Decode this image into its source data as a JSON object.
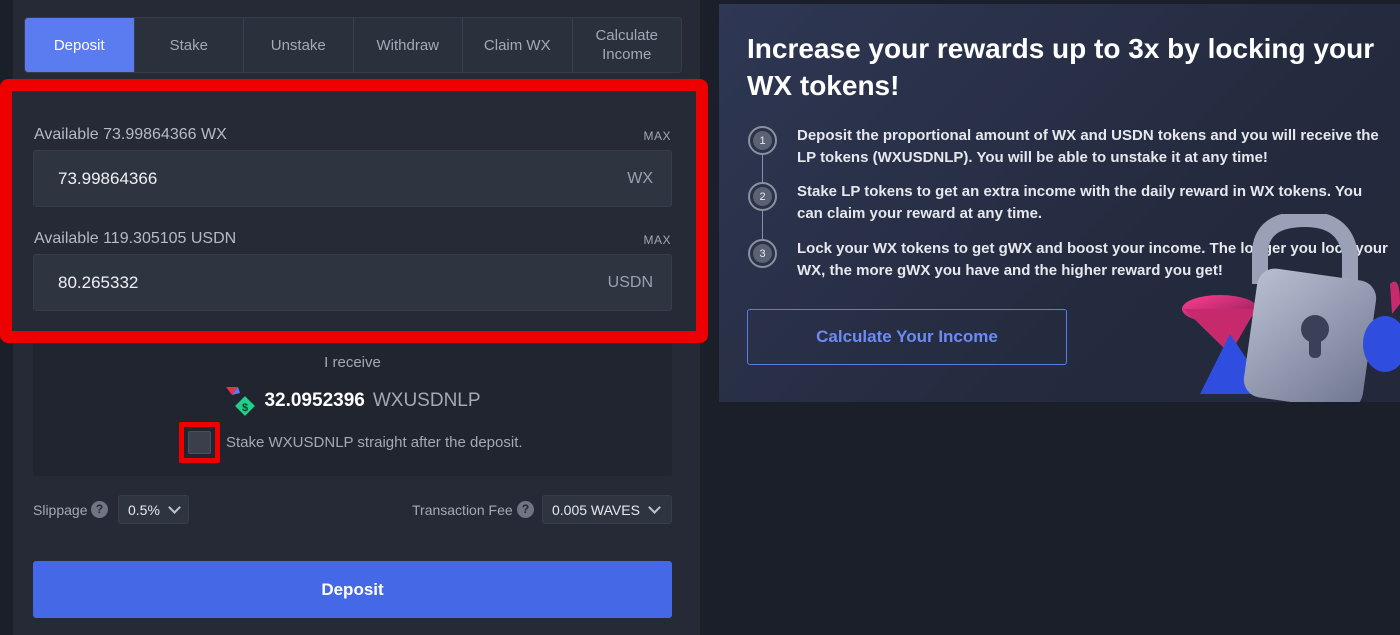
{
  "tabs": [
    {
      "label": "Deposit",
      "active": true
    },
    {
      "label": "Stake",
      "active": false
    },
    {
      "label": "Unstake",
      "active": false
    },
    {
      "label": "Withdraw",
      "active": false
    },
    {
      "label": "Claim WX",
      "active": false
    },
    {
      "label": "Calculate\nIncome",
      "active": false
    }
  ],
  "deposit": {
    "wx": {
      "available_label": "Available 73.99864366 WX",
      "max_label": "MAX",
      "value": "73.99864366",
      "unit": "WX"
    },
    "usdn": {
      "available_label": "Available 119.305105 USDN",
      "max_label": "MAX",
      "value": "80.265332",
      "unit": "USDN"
    }
  },
  "receive": {
    "label": "I receive",
    "amount": "32.0952396",
    "unit": "WXUSDNLP",
    "icon": "wxusdnlp-token-icon",
    "stake_checkbox_label": "Stake WXUSDNLP straight after the deposit.",
    "stake_checked": false
  },
  "settings": {
    "slippage_label": "Slippage",
    "slippage_value": "0.5%",
    "fee_label": "Transaction Fee",
    "fee_value": "0.005 WAVES",
    "help_glyph": "?"
  },
  "deposit_button_label": "Deposit",
  "promo": {
    "title": "Increase your rewards up to 3x by locking your WX tokens!",
    "steps": [
      {
        "num": "1",
        "text": "Deposit the proportional amount of WX and USDN tokens and you will receive the LP tokens (WXUSDNLP). You will be able to unstake it at any time!"
      },
      {
        "num": "2",
        "text": "Stake LP tokens to get an extra income with the daily reward in WX tokens. You can claim your reward at any time."
      },
      {
        "num": "3",
        "text": "Lock your WX tokens to get gWX and boost your income. The longer you lock your WX, the more gWX you have and the higher reward you get!"
      }
    ],
    "button_label": "Calculate Your Income",
    "art_icon": "padlock-illustration"
  },
  "colors": {
    "accent": "#4468e6",
    "tab_active": "#5a7cf0",
    "highlight": "#ee0000",
    "background": "#1b1f2a",
    "panel": "#252a36"
  }
}
